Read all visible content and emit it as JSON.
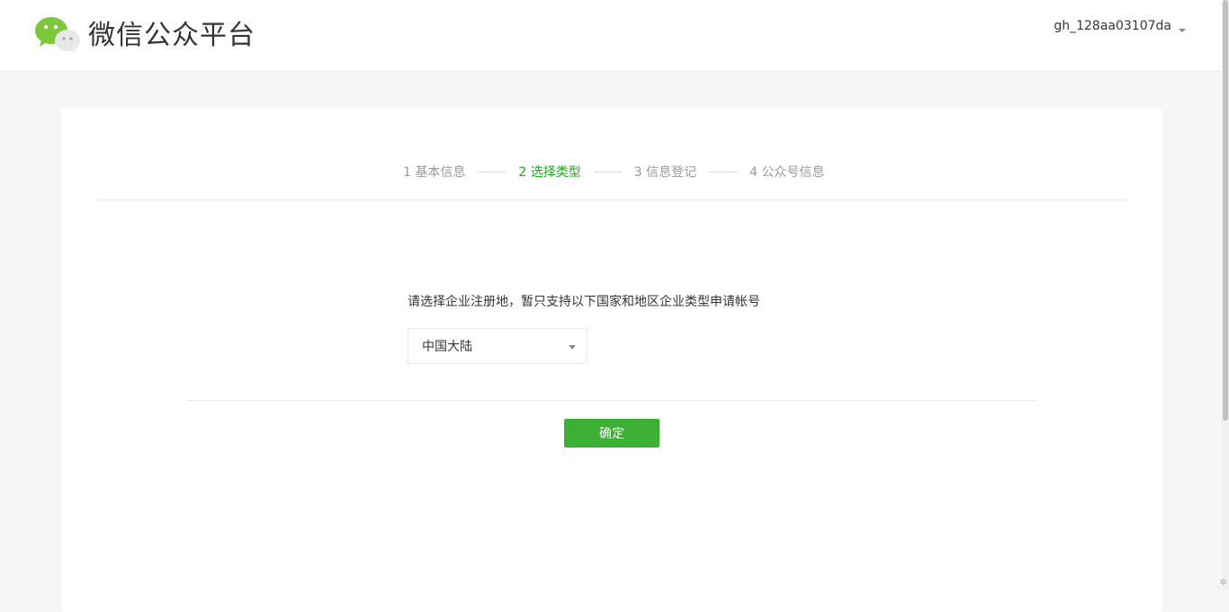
{
  "header": {
    "brand": "微信公众平台",
    "account": "gh_128aa03107da"
  },
  "steps": [
    {
      "label": "1 基本信息",
      "active": false
    },
    {
      "label": "2 选择类型",
      "active": true
    },
    {
      "label": "3 信息登记",
      "active": false
    },
    {
      "label": "4 公众号信息",
      "active": false
    }
  ],
  "form": {
    "prompt": "请选择企业注册地，暂只支持以下国家和地区企业类型申请帐号",
    "region_selected": "中国大陆",
    "confirm_label": "确定"
  },
  "colors": {
    "accent": "#1aad19",
    "button": "#3cb034"
  }
}
